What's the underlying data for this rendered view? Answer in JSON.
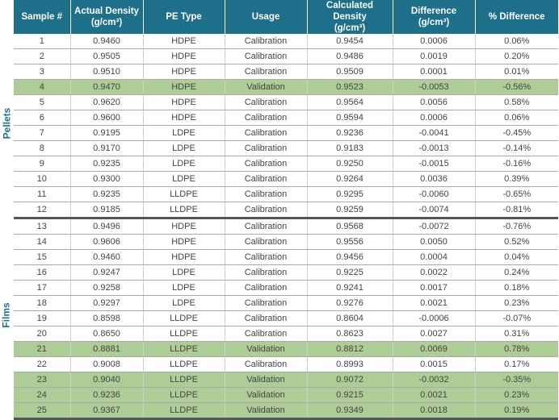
{
  "groups": {
    "pellets": "Pellets",
    "films": "Films"
  },
  "headers": [
    {
      "line1": "Sample #",
      "line2": ""
    },
    {
      "line1": "Actual Density",
      "line2": "(g/cm³)"
    },
    {
      "line1": "PE Type",
      "line2": ""
    },
    {
      "line1": "Usage",
      "line2": ""
    },
    {
      "line1": "Calculated Density",
      "line2": "(g/cm³)"
    },
    {
      "line1": "Difference",
      "line2": "(g/cm³)"
    },
    {
      "line1": "% Difference",
      "line2": ""
    }
  ],
  "rows": [
    {
      "sample": "1",
      "actual": "0.9460",
      "pe": "HDPE",
      "usage": "Calibration",
      "calc": "0.9454",
      "diff": "0.0006",
      "pct": "0.06%"
    },
    {
      "sample": "2",
      "actual": "0.9505",
      "pe": "HDPE",
      "usage": "Calibration",
      "calc": "0.9486",
      "diff": "0.0019",
      "pct": "0.20%"
    },
    {
      "sample": "3",
      "actual": "0.9510",
      "pe": "HDPE",
      "usage": "Calibration",
      "calc": "0.9509",
      "diff": "0.0001",
      "pct": "0.01%"
    },
    {
      "sample": "4",
      "actual": "0.9470",
      "pe": "HDPE",
      "usage": "Validation",
      "calc": "0.9523",
      "diff": "-0.0053",
      "pct": "-0.56%"
    },
    {
      "sample": "5",
      "actual": "0.9620",
      "pe": "HDPE",
      "usage": "Calibration",
      "calc": "0.9564",
      "diff": "0.0056",
      "pct": "0.58%"
    },
    {
      "sample": "6",
      "actual": "0.9600",
      "pe": "HDPE",
      "usage": "Calibration",
      "calc": "0.9594",
      "diff": "0.0006",
      "pct": "0.06%"
    },
    {
      "sample": "7",
      "actual": "0.9195",
      "pe": "LDPE",
      "usage": "Calibration",
      "calc": "0.9236",
      "diff": "-0.0041",
      "pct": "-0.45%"
    },
    {
      "sample": "8",
      "actual": "0.9170",
      "pe": "LDPE",
      "usage": "Calibration",
      "calc": "0.9183",
      "diff": "-0.0013",
      "pct": "-0.14%"
    },
    {
      "sample": "9",
      "actual": "0.9235",
      "pe": "LDPE",
      "usage": "Calibration",
      "calc": "0.9250",
      "diff": "-0.0015",
      "pct": "-0.16%"
    },
    {
      "sample": "10",
      "actual": "0.9300",
      "pe": "LDPE",
      "usage": "Calibration",
      "calc": "0.9264",
      "diff": "0.0036",
      "pct": "0.39%"
    },
    {
      "sample": "11",
      "actual": "0.9235",
      "pe": "LLDPE",
      "usage": "Calibration",
      "calc": "0.9295",
      "diff": "-0.0060",
      "pct": "-0.65%"
    },
    {
      "sample": "12",
      "actual": "0.9185",
      "pe": "LLDPE",
      "usage": "Calibration",
      "calc": "0.9259",
      "diff": "-0.0074",
      "pct": "-0.81%"
    },
    {
      "sample": "13",
      "actual": "0.9496",
      "pe": "HDPE",
      "usage": "Calibration",
      "calc": "0.9568",
      "diff": "-0.0072",
      "pct": "-0.76%"
    },
    {
      "sample": "14",
      "actual": "0.9606",
      "pe": "HDPE",
      "usage": "Calibration",
      "calc": "0.9556",
      "diff": "0.0050",
      "pct": "0.52%"
    },
    {
      "sample": "15",
      "actual": "0.9460",
      "pe": "HDPE",
      "usage": "Calibration",
      "calc": "0.9456",
      "diff": "0.0004",
      "pct": "0.04%"
    },
    {
      "sample": "16",
      "actual": "0.9247",
      "pe": "LDPE",
      "usage": "Calibration",
      "calc": "0.9225",
      "diff": "0.0022",
      "pct": "0.24%"
    },
    {
      "sample": "17",
      "actual": "0.9258",
      "pe": "LDPE",
      "usage": "Calibration",
      "calc": "0.9241",
      "diff": "0.0017",
      "pct": "0.18%"
    },
    {
      "sample": "18",
      "actual": "0.9297",
      "pe": "LDPE",
      "usage": "Calibration",
      "calc": "0.9276",
      "diff": "0.0021",
      "pct": "0.23%"
    },
    {
      "sample": "19",
      "actual": "0.8598",
      "pe": "LLDPE",
      "usage": "Calibration",
      "calc": "0.8604",
      "diff": "-0.0006",
      "pct": "-0.07%"
    },
    {
      "sample": "20",
      "actual": "0.8650",
      "pe": "LLDPE",
      "usage": "Calibration",
      "calc": "0.8623",
      "diff": "0.0027",
      "pct": "0.31%"
    },
    {
      "sample": "21",
      "actual": "0.8881",
      "pe": "LLDPE",
      "usage": "Validation",
      "calc": "0.8812",
      "diff": "0.0069",
      "pct": "0.78%"
    },
    {
      "sample": "22",
      "actual": "0.9008",
      "pe": "LLDPE",
      "usage": "Calibration",
      "calc": "0.8993",
      "diff": "0.0015",
      "pct": "0.17%"
    },
    {
      "sample": "23",
      "actual": "0.9040",
      "pe": "LLDPE",
      "usage": "Validation",
      "calc": "0.9072",
      "diff": "-0.0032",
      "pct": "-0.35%"
    },
    {
      "sample": "24",
      "actual": "0.9236",
      "pe": "LLDPE",
      "usage": "Validation",
      "calc": "0.9215",
      "diff": "0.0021",
      "pct": "0.23%"
    },
    {
      "sample": "25",
      "actual": "0.9367",
      "pe": "LLDPE",
      "usage": "Validation",
      "calc": "0.9349",
      "diff": "0.0018",
      "pct": "0.19%"
    }
  ],
  "colors": {
    "header_bg": "#1d6f8a",
    "header_text": "#ffffff",
    "validation_bg": "#aecc95",
    "group_label": "#1d6f8a"
  }
}
